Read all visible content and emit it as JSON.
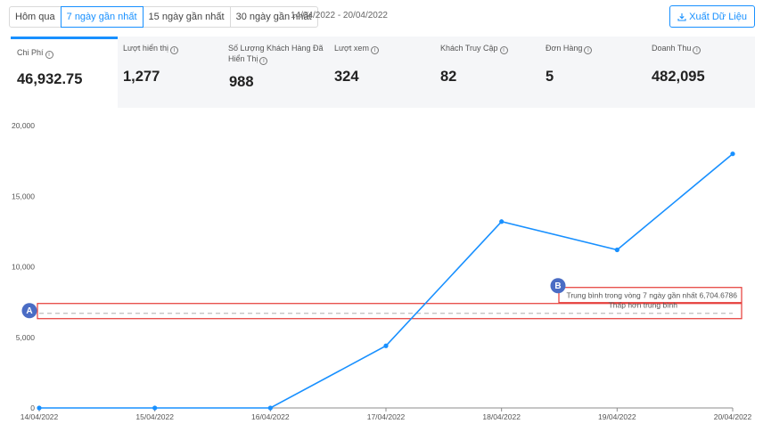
{
  "filters": {
    "buttons": [
      {
        "label": "Hôm qua",
        "active": false
      },
      {
        "label": "7 ngày gần nhất",
        "active": true
      },
      {
        "label": "15 ngày gần nhất",
        "active": false
      },
      {
        "label": "30 ngày gần nhất",
        "active": false
      }
    ],
    "date_range": "14/04/2022 - 20/04/2022"
  },
  "export": {
    "label": "Xuất Dữ Liệu",
    "icon": "download-icon"
  },
  "metrics": [
    {
      "label": "Chi Phí",
      "value": "46,932.75",
      "active": true
    },
    {
      "label": "Lượt hiển thị",
      "value": "1,277"
    },
    {
      "label_line1": "Số Lượng Khách Hàng Đã",
      "label_line2": "Hiển Thị",
      "value": "988"
    },
    {
      "label": "Lượt xem",
      "value": "324"
    },
    {
      "label": "Khách Truy Cập",
      "value": "82"
    },
    {
      "label": "Đơn Hàng",
      "value": "5"
    },
    {
      "label": "Doanh Thu",
      "value": "482,095"
    }
  ],
  "chart_data": {
    "type": "line",
    "categories": [
      "14/04/2022",
      "15/04/2022",
      "16/04/2022",
      "17/04/2022",
      "18/04/2022",
      "19/04/2022",
      "20/04/2022"
    ],
    "values": [
      0,
      0,
      0,
      4400,
      13200,
      11200,
      18000
    ],
    "y_ticks": [
      "0",
      "5,000",
      "10,000",
      "15,000",
      "20,000"
    ],
    "ylim": [
      0,
      20000
    ],
    "average_value": 6704.6786,
    "average_label": "Trung bình trong vòng 7 ngày gần nhất 6,704.6786",
    "below_label": "Thấp hơn trung bình",
    "line_color": "#1890ff",
    "average_line_color": "#bfbfbf",
    "grid": false
  },
  "annotations": [
    {
      "marker": "A",
      "color": "#4a6cc4",
      "box_color": "#e53935"
    },
    {
      "marker": "B",
      "color": "#4a6cc4",
      "box_color": "#e53935"
    }
  ]
}
